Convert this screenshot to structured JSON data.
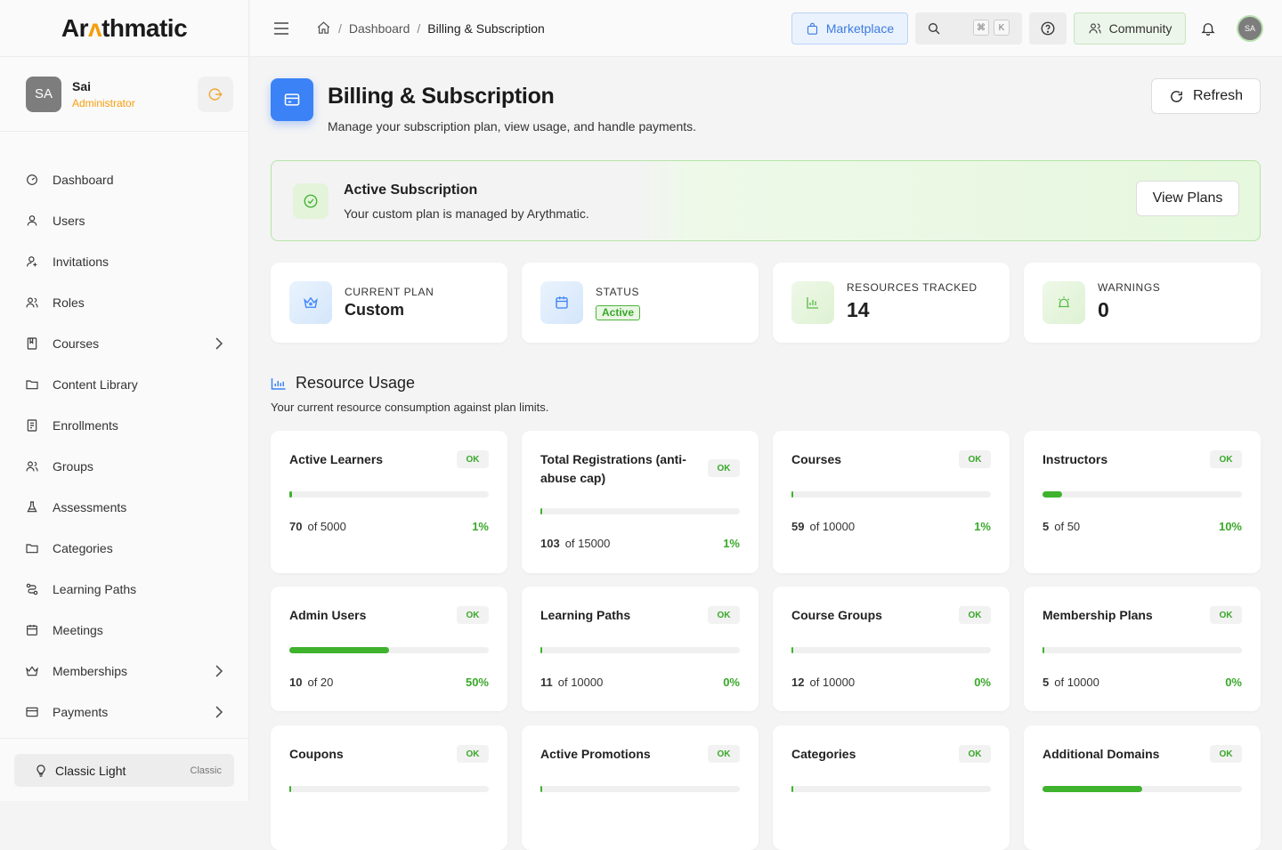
{
  "app": {
    "logo_prefix": "Ar",
    "logo_mark": "ʌ",
    "logo_suffix": "thmatic"
  },
  "user": {
    "initials": "SA",
    "name": "Sai",
    "role": "Administrator"
  },
  "nav": [
    {
      "label": "Dashboard",
      "icon": "dashboard-icon",
      "chevron": false
    },
    {
      "label": "Users",
      "icon": "user-icon",
      "chevron": false
    },
    {
      "label": "Invitations",
      "icon": "user-plus-icon",
      "chevron": false
    },
    {
      "label": "Roles",
      "icon": "users-icon",
      "chevron": false
    },
    {
      "label": "Courses",
      "icon": "book-icon",
      "chevron": true
    },
    {
      "label": "Content Library",
      "icon": "folder-icon",
      "chevron": false
    },
    {
      "label": "Enrollments",
      "icon": "clipboard-icon",
      "chevron": false
    },
    {
      "label": "Groups",
      "icon": "users-icon",
      "chevron": false
    },
    {
      "label": "Assessments",
      "icon": "flask-icon",
      "chevron": false
    },
    {
      "label": "Categories",
      "icon": "folder-icon",
      "chevron": false
    },
    {
      "label": "Learning Paths",
      "icon": "route-icon",
      "chevron": false
    },
    {
      "label": "Meetings",
      "icon": "calendar-icon",
      "chevron": false
    },
    {
      "label": "Memberships",
      "icon": "crown-icon",
      "chevron": true
    },
    {
      "label": "Payments",
      "icon": "card-icon",
      "chevron": true
    }
  ],
  "theme": {
    "label": "Classic Light",
    "tag": "Classic"
  },
  "breadcrumb": {
    "sep": "/",
    "parent": "Dashboard",
    "current": "Billing & Subscription"
  },
  "topbar": {
    "marketplace": "Marketplace",
    "kbd_mod": "⌘",
    "kbd_key": "K",
    "community": "Community",
    "avatar": "SA"
  },
  "page": {
    "title": "Billing & Subscription",
    "subtitle": "Manage your subscription plan, view usage, and handle payments.",
    "refresh": "Refresh"
  },
  "banner": {
    "title": "Active Subscription",
    "subtitle": "Your custom plan is managed by Arythmatic.",
    "button": "View Plans"
  },
  "stats": [
    {
      "label": "CURRENT PLAN",
      "value": "Custom",
      "icon": "crown-icon"
    },
    {
      "label": "STATUS",
      "value": "Active",
      "icon": "calendar-icon"
    },
    {
      "label": "RESOURCES TRACKED",
      "value": "14",
      "icon": "chart-icon"
    },
    {
      "label": "WARNINGS",
      "value": "0",
      "icon": "alarm-icon"
    }
  ],
  "usage": {
    "title": "Resource Usage",
    "subtitle": "Your current resource consumption against plan limits.",
    "items": [
      {
        "name": "Active Learners",
        "status": "OK",
        "used": "70",
        "limit": "of 5000",
        "percent": "1%",
        "fraction": 0.014
      },
      {
        "name": "Total Registrations (anti-abuse cap)",
        "status": "OK",
        "used": "103",
        "limit": "of 15000",
        "percent": "1%",
        "fraction": 0.007
      },
      {
        "name": "Courses",
        "status": "OK",
        "used": "59",
        "limit": "of 10000",
        "percent": "1%",
        "fraction": 0.006
      },
      {
        "name": "Instructors",
        "status": "OK",
        "used": "5",
        "limit": "of 50",
        "percent": "10%",
        "fraction": 0.1
      },
      {
        "name": "Admin Users",
        "status": "OK",
        "used": "10",
        "limit": "of 20",
        "percent": "50%",
        "fraction": 0.5
      },
      {
        "name": "Learning Paths",
        "status": "OK",
        "used": "11",
        "limit": "of 10000",
        "percent": "0%",
        "fraction": 0.001
      },
      {
        "name": "Course Groups",
        "status": "OK",
        "used": "12",
        "limit": "of 10000",
        "percent": "0%",
        "fraction": 0.001
      },
      {
        "name": "Membership Plans",
        "status": "OK",
        "used": "5",
        "limit": "of 10000",
        "percent": "0%",
        "fraction": 0.0005
      },
      {
        "name": "Coupons",
        "status": "OK",
        "fraction": 0
      },
      {
        "name": "Active Promotions",
        "status": "OK",
        "fraction": 0.001
      },
      {
        "name": "Categories",
        "status": "OK",
        "fraction": 0.001
      },
      {
        "name": "Additional Domains",
        "status": "OK",
        "fraction": 0.5
      }
    ]
  },
  "colors": {
    "accent": "#3b82f6",
    "success": "#3fb22e",
    "warning": "#f59e0b"
  }
}
